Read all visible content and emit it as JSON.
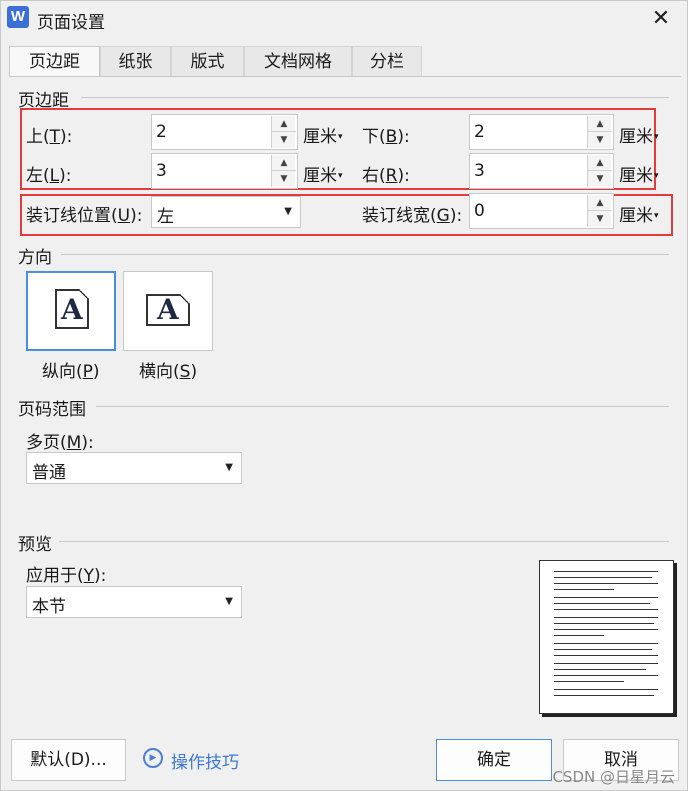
{
  "window": {
    "title": "页面设置",
    "app_icon": "W"
  },
  "tabs": [
    {
      "label": "页边距",
      "active": true
    },
    {
      "label": "纸张"
    },
    {
      "label": "版式"
    },
    {
      "label": "文档网格"
    },
    {
      "label": "分栏"
    }
  ],
  "margins": {
    "section_label": "页边距",
    "top": {
      "label_pre": "上(",
      "key": "T",
      "label_post": "):",
      "value": "2",
      "unit": "厘米"
    },
    "bottom": {
      "label_pre": "下(",
      "key": "B",
      "label_post": "):",
      "value": "2",
      "unit": "厘米"
    },
    "left": {
      "label_pre": "左(",
      "key": "L",
      "label_post": "):",
      "value": "3",
      "unit": "厘米"
    },
    "right": {
      "label_pre": "右(",
      "key": "R",
      "label_post": "):",
      "value": "3",
      "unit": "厘米"
    },
    "gutter_pos": {
      "label_pre": "装订线位置(",
      "key": "U",
      "label_post": "):",
      "value": "左"
    },
    "gutter_width": {
      "label_pre": "装订线宽(",
      "key": "G",
      "label_post": "):",
      "value": "0",
      "unit": "厘米"
    }
  },
  "orientation": {
    "section_label": "方向",
    "portrait": {
      "label_pre": "纵向(",
      "key": "P",
      "label_post": ")",
      "glyph": "A",
      "selected": true
    },
    "landscape": {
      "label_pre": "横向(",
      "key": "S",
      "label_post": ")",
      "glyph": "A"
    }
  },
  "page_range": {
    "section_label": "页码范围",
    "multi_label_pre": "多页(",
    "multi_key": "M",
    "multi_label_post": "):",
    "multi_value": "普通"
  },
  "preview": {
    "section_label": "预览",
    "apply_label_pre": "应用于(",
    "apply_key": "Y",
    "apply_label_post": "):",
    "apply_value": "本节"
  },
  "footer": {
    "default_button": "默认(D)...",
    "tips_link": "操作技巧",
    "ok_button": "确定",
    "cancel_button": "取消"
  },
  "watermark": "CSDN @日星月云",
  "colors": {
    "highlight_box": "#e03c3c",
    "link": "#3c78d8",
    "accent": "#4a90d9"
  }
}
